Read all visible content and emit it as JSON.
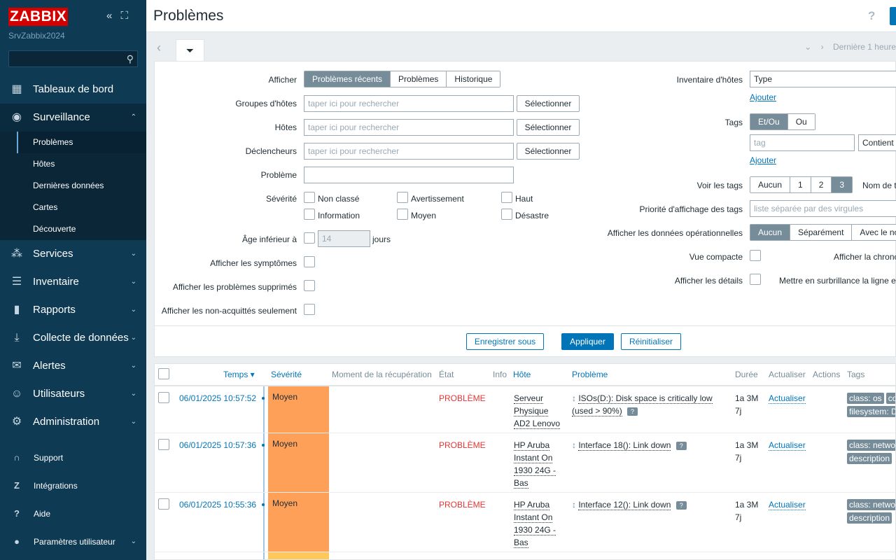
{
  "sidebar": {
    "logo": "ZABBIX",
    "server_name": "SrvZabbix2024",
    "collapse_glyph": "«",
    "expand_glyph": "⛶",
    "search_placeholder": "",
    "menu": [
      {
        "label": "Tableaux de bord",
        "icon": "dashboard-icon"
      },
      {
        "label": "Surveillance",
        "icon": "eye-icon"
      },
      {
        "label": "Services",
        "icon": "services-icon"
      },
      {
        "label": "Inventaire",
        "icon": "list-icon"
      },
      {
        "label": "Rapports",
        "icon": "reports-icon"
      },
      {
        "label": "Collecte de données",
        "icon": "download-icon"
      },
      {
        "label": "Alertes",
        "icon": "mail-icon"
      },
      {
        "label": "Utilisateurs",
        "icon": "users-icon"
      },
      {
        "label": "Administration",
        "icon": "gear-icon"
      }
    ],
    "submenu": [
      "Problèmes",
      "Hôtes",
      "Dernières données",
      "Cartes",
      "Découverte"
    ],
    "bottom": [
      {
        "label": "Support",
        "icon": "headset-icon"
      },
      {
        "label": "Intégrations",
        "icon": "integrations-icon"
      },
      {
        "label": "Aide",
        "icon": "help-icon"
      },
      {
        "label": "Paramètres utilisateur",
        "icon": "user-icon"
      }
    ]
  },
  "header": {
    "title": "Problèmes",
    "help": "?"
  },
  "timenav": {
    "label": "Dernière 1 heure"
  },
  "filter": {
    "afficher_label": "Afficher",
    "afficher_options": [
      "Problèmes récents",
      "Problèmes",
      "Historique"
    ],
    "groupes_label": "Groupes d'hôtes",
    "hotes_label": "Hôtes",
    "declencheurs_label": "Déclencheurs",
    "probleme_label": "Problème",
    "search_placeholder": "taper ici pour rechercher",
    "select_btn": "Sélectionner",
    "severite_label": "Sévérité",
    "severities": [
      "Non classé",
      "Avertissement",
      "Haut",
      "Information",
      "Moyen",
      "Désastre"
    ],
    "age_label": "Âge inférieur à",
    "age_value": "14",
    "age_unit": "jours",
    "symptomes_label": "Afficher les symptômes",
    "supprimes_label": "Afficher les problèmes supprimés",
    "nonack_label": "Afficher les non-acquittés seulement",
    "inventaire_label": "Inventaire d'hôtes",
    "inventaire_value": "Type",
    "ajouter": "Ajouter",
    "tags_label": "Tags",
    "tags_options": [
      "Et/Ou",
      "Ou"
    ],
    "tag_placeholder": "tag",
    "tag_operator": "Contient",
    "voir_tags_label": "Voir les tags",
    "voir_tags_options": [
      "Aucun",
      "1",
      "2",
      "3"
    ],
    "nom_tags_label": "Nom de t",
    "priorite_label": "Priorité d'affichage des tags",
    "priorite_placeholder": "liste séparée par des virgules",
    "operationnel_label": "Afficher les données opérationnelles",
    "operationnel_options": [
      "Aucun",
      "Séparément",
      "Avec le no"
    ],
    "compacte_label": "Vue compacte",
    "chrono_label": "Afficher la chronc",
    "details_label": "Afficher les détails",
    "surbrillance_label": "Mettre en surbrillance la ligne en",
    "save_as": "Enregistrer sous",
    "apply": "Appliquer",
    "reset": "Réinitialiser"
  },
  "table": {
    "headers": {
      "time": "Temps ▾",
      "severity": "Sévérité",
      "recovery": "Moment de la récupération",
      "state": "État",
      "info": "Info",
      "host": "Hôte",
      "problem": "Problème",
      "duration": "Durée",
      "update": "Actualiser",
      "actions": "Actions",
      "tags": "Tags"
    },
    "rows": [
      {
        "time": "06/01/2025 10:57:52",
        "severity": "Moyen",
        "state": "PROBLÈME",
        "host": [
          "Serveur",
          "Physique",
          "AD2 Lenovo"
        ],
        "problem": [
          "ISOs(D:): Disk space is critically low",
          "(used > 90%)"
        ],
        "duration": [
          "1a 3M",
          "7j"
        ],
        "update": "Actualiser",
        "tags": [
          "class: os",
          "co",
          "filesystem: D"
        ]
      },
      {
        "time": "06/01/2025 10:57:36",
        "severity": "Moyen",
        "state": "PROBLÈME",
        "host": [
          "HP Aruba",
          "Instant On",
          "1930 24G -",
          "Bas"
        ],
        "problem": [
          "Interface 18(): Link down"
        ],
        "duration": [
          "1a 3M",
          "7j"
        ],
        "update": "Actualiser",
        "tags": [
          "class: networ",
          "description"
        ]
      },
      {
        "time": "06/01/2025 10:55:36",
        "severity": "Moyen",
        "state": "PROBLÈME",
        "host": [
          "HP Aruba",
          "Instant On",
          "1930 24G -",
          "Bas"
        ],
        "problem": [
          "Interface 12(): Link down"
        ],
        "duration": [
          "1a 3M",
          "7j"
        ],
        "update": "Actualiser",
        "tags": [
          "class: networ",
          "description"
        ]
      }
    ]
  },
  "colors": {
    "sidebar": "#0e3a54",
    "accent": "#0275b8",
    "severity_average": "#ffa059",
    "severity_warning": "#ffc859",
    "problem_red": "#e33734"
  }
}
